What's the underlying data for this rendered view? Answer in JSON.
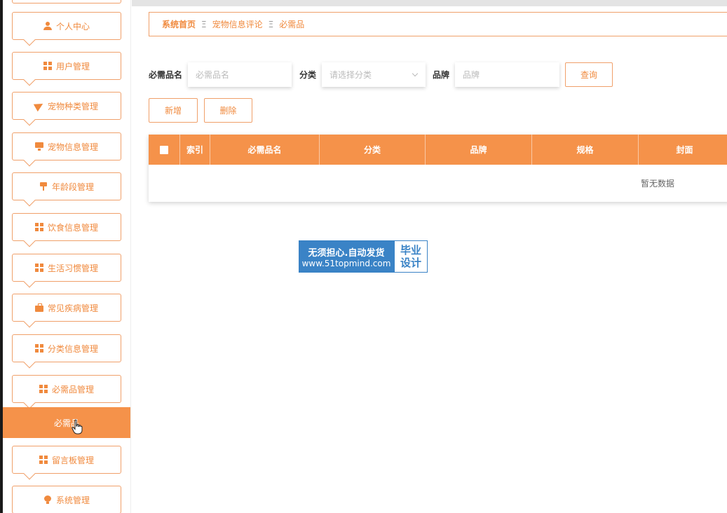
{
  "sidebar": {
    "items": [
      {
        "label": "个人中心",
        "icon": "user-icon"
      },
      {
        "label": "用户管理",
        "icon": "grid-icon"
      },
      {
        "label": "宠物种类管理",
        "icon": "paper-plane-icon"
      },
      {
        "label": "宠物信息管理",
        "icon": "monitor-icon"
      },
      {
        "label": "年龄段管理",
        "icon": "brush-icon"
      },
      {
        "label": "饮食信息管理",
        "icon": "grid-icon"
      },
      {
        "label": "生活习惯管理",
        "icon": "grid-icon"
      },
      {
        "label": "常见疾病管理",
        "icon": "briefcase-icon"
      },
      {
        "label": "分类信息管理",
        "icon": "grid-icon"
      },
      {
        "label": "必需品管理",
        "icon": "grid-icon"
      },
      {
        "label": "留言板管理",
        "icon": "grid-icon"
      },
      {
        "label": "系统管理",
        "icon": "bulb-icon"
      }
    ],
    "active_sub": "必需品"
  },
  "breadcrumb": {
    "items": [
      "系统首页",
      "宠物信息评论",
      "必需品"
    ],
    "separator": "Ξ"
  },
  "search": {
    "name_label": "必需品名",
    "name_placeholder": "必需品名",
    "category_label": "分类",
    "category_placeholder": "请选择分类",
    "brand_label": "品牌",
    "brand_placeholder": "品牌",
    "query_button": "查询"
  },
  "actions": {
    "add": "新增",
    "delete": "删除"
  },
  "table": {
    "columns": [
      "索引",
      "必需品名",
      "分类",
      "品牌",
      "规格",
      "封面"
    ],
    "empty_text": "暂无数据"
  },
  "watermark": {
    "line1": "无须担心.自动发货",
    "line2": "www.51topmind.com",
    "right1": "毕业",
    "right2": "设计"
  },
  "colors": {
    "accent": "#f5924a",
    "border": "#f0a06a",
    "text_accent": "#f08a3e"
  }
}
